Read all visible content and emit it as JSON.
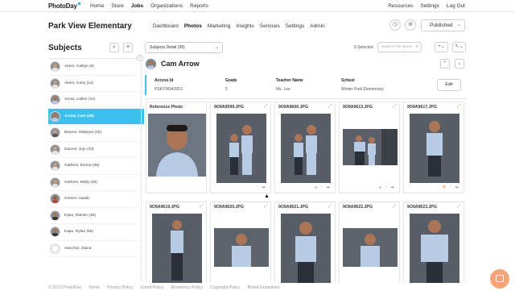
{
  "app": {
    "logo": "PhotoDay"
  },
  "topnav": {
    "links": [
      "Home",
      "Store",
      "Jobs",
      "Organizations",
      "Reports"
    ],
    "active": "Jobs",
    "right": [
      "Resources",
      "Settings",
      "Log Out"
    ]
  },
  "job": {
    "school": "Park View Elementary",
    "tabs": [
      "Dashboard",
      "Photos",
      "Marketing",
      "Insights",
      "Services",
      "Settings",
      "Admin"
    ],
    "active_tab": "Photos",
    "status": "Published"
  },
  "sidebar": {
    "title": "Subjects",
    "items": [
      {
        "label": "Akers, Caitlyn (6)"
      },
      {
        "label": "Akers, Carly (14)"
      },
      {
        "label": "Arrow, Callen (10)"
      },
      {
        "label": "Arrow, Cam (38)",
        "selected": true
      },
      {
        "label": "Banner, Malayna (25)"
      },
      {
        "label": "Danzer, Jojo (23)"
      },
      {
        "label": "Gathers, Emma (36)"
      },
      {
        "label": "Gathers, Molly (35)"
      },
      {
        "label": "Gomez, Isaiah"
      },
      {
        "label": "Kapo, Rainen (29)"
      },
      {
        "label": "Kapo, Rylan (56)"
      },
      {
        "label": "Sanchez, Elana"
      }
    ]
  },
  "toolbar": {
    "filter": "Subjects Detail (38)",
    "selected": "0 Selected",
    "search_placeholder": "Search File Name"
  },
  "student": {
    "name": "Cam Arrow",
    "fields": [
      {
        "label": "Access Id",
        "value": "PSKYW942653"
      },
      {
        "label": "Grade",
        "value": "5"
      },
      {
        "label": "Teacher Name",
        "value": "Ms. Lee"
      },
      {
        "label": "School",
        "value": "Winter Park Elementary"
      }
    ],
    "edit_label": "Edit"
  },
  "photos": [
    {
      "name": "Reference Photo"
    },
    {
      "name": "9O9A9599.JPG"
    },
    {
      "name": "9O9A9600.JPG"
    },
    {
      "name": "9O9A9613.JPG"
    },
    {
      "name": "9O9A9617.JPG"
    },
    {
      "name": "9O9A9619.JPG"
    },
    {
      "name": "9O9A9620.JPG"
    },
    {
      "name": "9O9A9621.JPG"
    },
    {
      "name": "9O9A9622.JPG"
    },
    {
      "name": "9O9A9623.JPG"
    }
  ],
  "footer": [
    "© 2022 PhotoDay",
    "Terms",
    "Privacy Policy",
    "Credit Policy",
    "Biometrics Policy",
    "Copyright Policy",
    "Brand Guidelines"
  ],
  "colors": {
    "accent": "#3cc1ef",
    "chat": "#f5a575"
  }
}
